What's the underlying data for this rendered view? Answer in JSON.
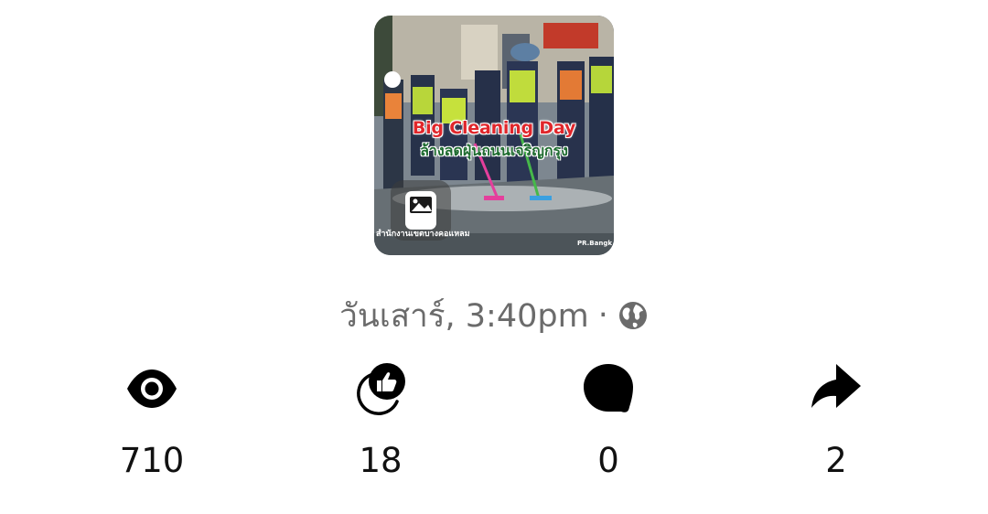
{
  "post": {
    "thumbnail": {
      "headline": "Big Cleaning Day",
      "subline": "ล้างลดฝุ่นถนนเจริญกรุง",
      "credit_left": "สำนักงานเขตบางคอแหลม",
      "credit_right": "PR.Bangk",
      "badge_icon": "image-gallery-icon"
    },
    "timestamp": "วันเสาร์, 3:40pm",
    "separator": "·",
    "audience_icon": "globe-icon"
  },
  "stats": {
    "views": {
      "icon": "eye-icon",
      "value": "710"
    },
    "reactions": {
      "icon": "like-reaction-icon",
      "value": "18"
    },
    "comments": {
      "icon": "comment-bubble-icon",
      "value": "0"
    },
    "shares": {
      "icon": "share-arrow-icon",
      "value": "2"
    }
  },
  "colors": {
    "stat_text": "#111111",
    "meta_text": "#6b6b6b",
    "headline_red": "#e0262b",
    "subline_green": "#1e6b2f"
  }
}
